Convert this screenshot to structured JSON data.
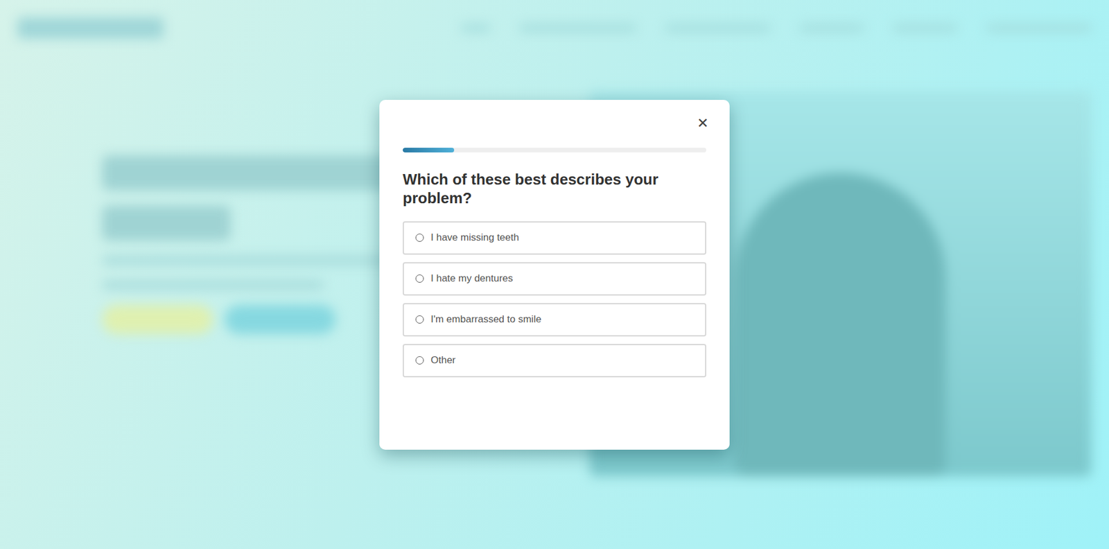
{
  "quiz": {
    "close": "✕",
    "progress": {
      "level": 0.17
    },
    "question": "Which of these best describes your problem?",
    "options": [
      {
        "label": "I have missing teeth",
        "selected": false
      },
      {
        "label": "I hate my dentures",
        "selected": false
      },
      {
        "label": "I'm embarrassed to smile",
        "selected": false
      },
      {
        "label": "Other",
        "selected": false
      }
    ]
  }
}
